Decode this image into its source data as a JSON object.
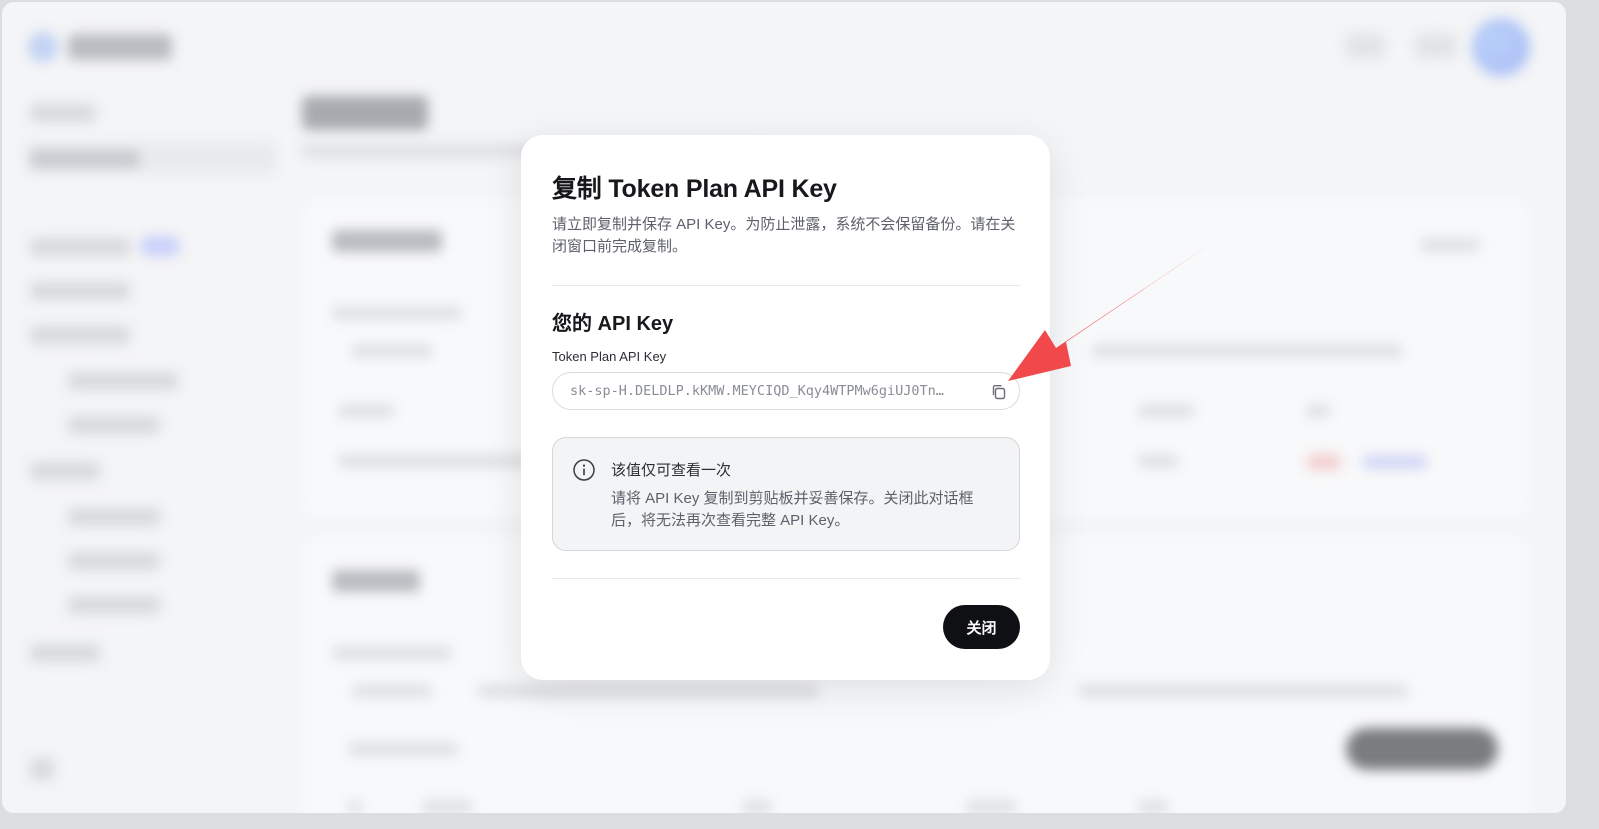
{
  "modal": {
    "title": "复制 Token Plan API Key",
    "description": "请立即复制并保存 API Key。为防止泄露，系统不会保留备份。请在关闭窗口前完成复制。",
    "section_title": "您的 API Key",
    "field_label": "Token Plan API Key",
    "key_value": "sk-sp-H.DELDLP.kKMW.MEYCIQD_Kqy4WTPMw6giUJ0Tn…",
    "copy_icon": "copy-icon",
    "info": {
      "icon": "info-icon",
      "heading": "该值仅可查看一次",
      "text": "请将 API Key 复制到剪贴板并妥善保存。关闭此对话框后，将无法再次查看完整 API Key。"
    },
    "close_label": "关闭"
  },
  "colors": {
    "primary_button": "#0f1014",
    "annotation_arrow": "#f0484b",
    "info_background": "#f3f4f6"
  }
}
